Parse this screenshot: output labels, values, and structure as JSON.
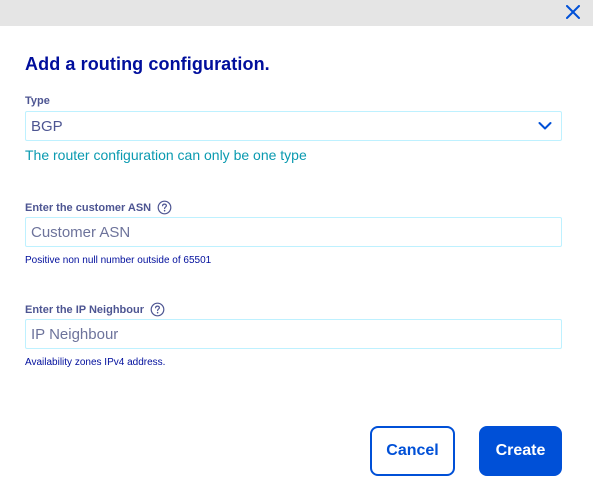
{
  "dialog": {
    "title": "Add a routing configuration.",
    "close_icon": "close-icon"
  },
  "type_field": {
    "label": "Type",
    "value": "BGP",
    "icon": "chevron-down-icon",
    "info": "The router configuration can only be one type"
  },
  "asn_field": {
    "label": "Enter the customer ASN",
    "help_icon": "help-icon",
    "placeholder": "Customer ASN",
    "helper": "Positive non null number outside of 65501"
  },
  "ip_field": {
    "label": "Enter the IP Neighbour",
    "help_icon": "help-icon",
    "placeholder": "IP Neighbour",
    "helper": "Availability zones IPv4 address."
  },
  "actions": {
    "cancel_label": "Cancel",
    "create_label": "Create"
  },
  "colors": {
    "primary": "#0050d7",
    "title": "#000e9c",
    "info_teal": "#0a9ab0",
    "input_border": "#bef1ff"
  }
}
